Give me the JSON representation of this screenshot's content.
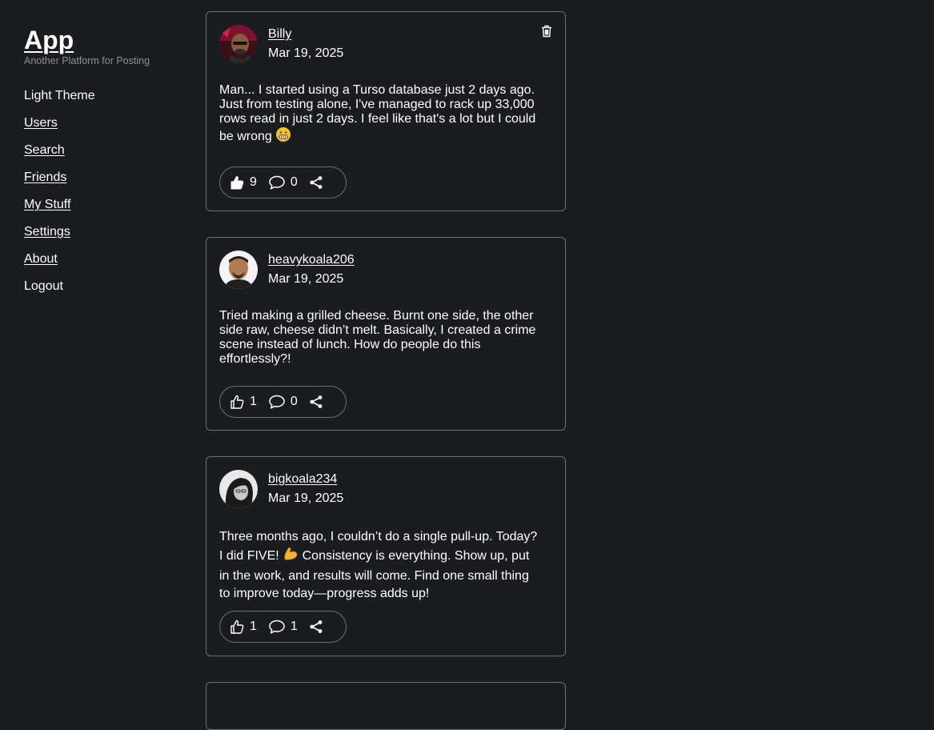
{
  "app": {
    "title": "App",
    "subtitle": "Another Platform for Posting"
  },
  "nav": {
    "theme": "Light Theme",
    "users": "Users",
    "search": "Search",
    "friends": "Friends",
    "my_stuff": "My Stuff",
    "settings": "Settings",
    "about": "About",
    "logout": "Logout"
  },
  "posts": [
    {
      "username": "Billy",
      "date": "Mar 19, 2025",
      "body": "Man... I started using a Turso database just 2 days ago. Just from testing alone, I've managed to rack up 33,000 rows read in just 2 days. I feel like that's a lot but I could be wrong",
      "emoji": "grimacing-face",
      "likes": "9",
      "comments": "0",
      "liked": true,
      "can_delete": true
    },
    {
      "username": "heavykoala206",
      "date": "Mar 19, 2025",
      "body": "Tried making a grilled cheese. Burnt one side, the other side raw, cheese didn’t melt. Basically, I created a crime scene instead of lunch. How do people do this effortlessly?!",
      "likes": "1",
      "comments": "0",
      "liked": false
    },
    {
      "username": "bigkoala234",
      "date": "Mar 19, 2025",
      "body_part1": "Three months ago, I couldn’t do a single pull-up. Today? I did FIVE!",
      "emoji": "flexed-biceps",
      "body_part2": "Consistency is everything. Show up, put in the work, and results will come. Find one small thing to improve today—progress adds up!",
      "likes": "1",
      "comments": "1",
      "liked": false
    }
  ],
  "colors": {
    "background": "#1b1c1f",
    "border": "#6c6e73",
    "text": "#ffffff",
    "muted": "#8d8f94"
  }
}
